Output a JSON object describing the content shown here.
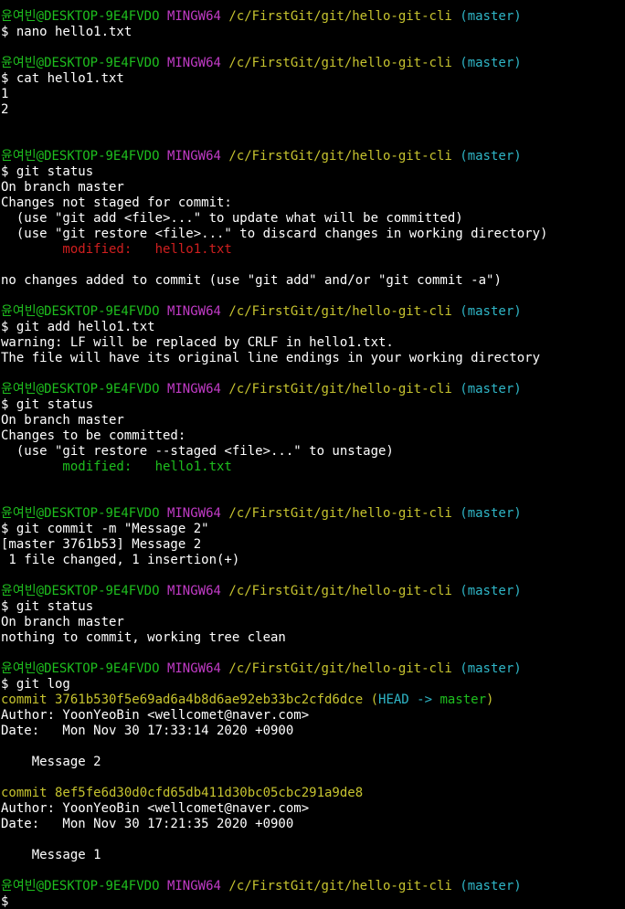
{
  "prompt": {
    "user_host": "윤여빈@DESKTOP-9E4FVDO",
    "system": "MINGW64",
    "path": "/c/FirstGit/git/hello-git-cli",
    "branch": "(master)",
    "dollar": "$"
  },
  "colors": {
    "background": "#000000",
    "text": "#ffffff",
    "user_host": "#1ebe1e",
    "system": "#c13bc6",
    "path": "#c7c42f",
    "branch": "#2fb6c7",
    "modified_unstaged": "#d01f1f",
    "modified_staged": "#1ebe1e"
  },
  "lines": [
    {
      "kind": "prompt"
    },
    {
      "kind": "cmd",
      "text": "$ nano hello1.txt"
    },
    {
      "kind": "blank"
    },
    {
      "kind": "prompt"
    },
    {
      "kind": "cmd",
      "text": "$ cat hello1.txt"
    },
    {
      "kind": "out",
      "text": "1"
    },
    {
      "kind": "out",
      "text": "2"
    },
    {
      "kind": "blank"
    },
    {
      "kind": "blank"
    },
    {
      "kind": "prompt"
    },
    {
      "kind": "cmd",
      "text": "$ git status"
    },
    {
      "kind": "out",
      "text": "On branch master"
    },
    {
      "kind": "out",
      "text": "Changes not staged for commit:"
    },
    {
      "kind": "out",
      "text": "  (use \"git add <file>...\" to update what will be committed)"
    },
    {
      "kind": "out",
      "text": "  (use \"git restore <file>...\" to discard changes in working directory)"
    },
    {
      "kind": "colored",
      "color": "red",
      "text": "        modified:   hello1.txt"
    },
    {
      "kind": "blank"
    },
    {
      "kind": "out",
      "text": "no changes added to commit (use \"git add\" and/or \"git commit -a\")"
    },
    {
      "kind": "blank"
    },
    {
      "kind": "prompt"
    },
    {
      "kind": "cmd",
      "text": "$ git add hello1.txt"
    },
    {
      "kind": "out",
      "text": "warning: LF will be replaced by CRLF in hello1.txt."
    },
    {
      "kind": "out",
      "text": "The file will have its original line endings in your working directory"
    },
    {
      "kind": "blank"
    },
    {
      "kind": "prompt"
    },
    {
      "kind": "cmd",
      "text": "$ git status"
    },
    {
      "kind": "out",
      "text": "On branch master"
    },
    {
      "kind": "out",
      "text": "Changes to be committed:"
    },
    {
      "kind": "out",
      "text": "  (use \"git restore --staged <file>...\" to unstage)"
    },
    {
      "kind": "colored",
      "color": "green",
      "text": "        modified:   hello1.txt"
    },
    {
      "kind": "blank"
    },
    {
      "kind": "blank"
    },
    {
      "kind": "prompt"
    },
    {
      "kind": "cmd",
      "text": "$ git commit -m \"Message 2\""
    },
    {
      "kind": "out",
      "text": "[master 3761b53] Message 2"
    },
    {
      "kind": "out",
      "text": " 1 file changed, 1 insertion(+)"
    },
    {
      "kind": "blank"
    },
    {
      "kind": "prompt"
    },
    {
      "kind": "cmd",
      "text": "$ git status"
    },
    {
      "kind": "out",
      "text": "On branch master"
    },
    {
      "kind": "out",
      "text": "nothing to commit, working tree clean"
    },
    {
      "kind": "blank"
    },
    {
      "kind": "prompt"
    },
    {
      "kind": "cmd",
      "text": "$ git log"
    },
    {
      "kind": "commit",
      "hash": "commit 3761b530f5e69ad6a4b8d6ae92eb33bc2cfd6dce",
      "ref_open": " (",
      "ref_head": "HEAD -> ",
      "ref_branch": "master",
      "ref_close": ")"
    },
    {
      "kind": "out",
      "text": "Author: YoonYeoBin <wellcomet@naver.com>"
    },
    {
      "kind": "out",
      "text": "Date:   Mon Nov 30 17:33:14 2020 +0900"
    },
    {
      "kind": "blank"
    },
    {
      "kind": "out",
      "text": "    Message 2"
    },
    {
      "kind": "blank"
    },
    {
      "kind": "commit",
      "hash": "commit 8ef5fe6d30d0cfd65db411d30bc05cbc291a9de8"
    },
    {
      "kind": "out",
      "text": "Author: YoonYeoBin <wellcomet@naver.com>"
    },
    {
      "kind": "out",
      "text": "Date:   Mon Nov 30 17:21:35 2020 +0900"
    },
    {
      "kind": "blank"
    },
    {
      "kind": "out",
      "text": "    Message 1"
    },
    {
      "kind": "blank"
    },
    {
      "kind": "prompt"
    },
    {
      "kind": "cmd",
      "text": "$"
    }
  ]
}
